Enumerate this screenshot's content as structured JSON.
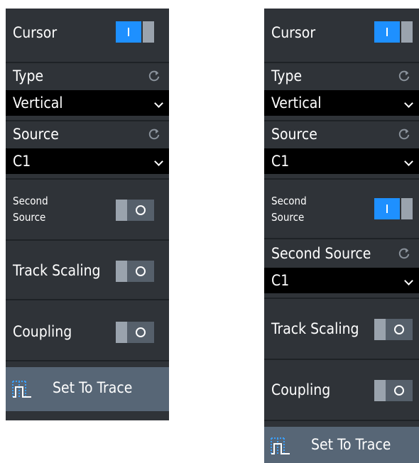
{
  "left_panel": {
    "cursor_label": "Cursor",
    "cursor_state": "on",
    "type_label": "Type",
    "type_value": "Vertical",
    "source_label": "Source",
    "source_value": "C1",
    "second_source_label_1": "Second",
    "second_source_label_2": "Source",
    "second_source_state": "off",
    "track_scaling_label": "Track Scaling",
    "track_scaling_state": "off",
    "coupling_label": "Coupling",
    "coupling_state": "off",
    "set_to_trace_label": "Set To Trace"
  },
  "right_panel": {
    "cursor_label": "Cursor",
    "cursor_state": "on",
    "type_label": "Type",
    "type_value": "Vertical",
    "source_label": "Source",
    "source_value": "C1",
    "second_source_label_1": "Second",
    "second_source_label_2": "Source",
    "second_source_state": "on",
    "second_source_dropdown_label": "Second Source",
    "second_source_value": "C1",
    "track_scaling_label": "Track Scaling",
    "track_scaling_state": "off",
    "coupling_label": "Coupling",
    "coupling_state": "off",
    "set_to_trace_label": "Set To Trace"
  },
  "icons": {
    "reset": "reset-icon",
    "dropdown": "chevron-down-icon",
    "trace": "set-to-trace-icon"
  },
  "colors": {
    "panel_bg": "#2f3338",
    "toggle_on": "#1e90ff",
    "toggle_off": "#56606b",
    "button_bg": "#576676",
    "dropdown_bg": "#000000"
  }
}
